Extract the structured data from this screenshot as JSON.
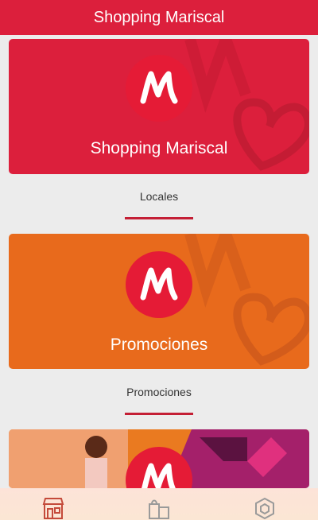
{
  "header": {
    "title": "Shopping Mariscal"
  },
  "cards": [
    {
      "title": "Shopping Mariscal",
      "color": "#dc1f3c"
    },
    {
      "title": "Promociones",
      "color": "#e86a1c"
    },
    {
      "title": "",
      "color": "#ea7a20"
    }
  ],
  "sections": [
    {
      "label": "Locales"
    },
    {
      "label": "Promociones"
    }
  ],
  "logo": {
    "letter": "M",
    "icon": "mariscal-logo-icon"
  },
  "bottom_nav": [
    {
      "icon": "store-icon"
    },
    {
      "icon": "shopping-bags-icon"
    },
    {
      "icon": "hexagon-icon"
    }
  ],
  "colors": {
    "brand_red": "#dc1f3c",
    "promo_orange": "#e86a1c",
    "underline": "#c41f35"
  }
}
